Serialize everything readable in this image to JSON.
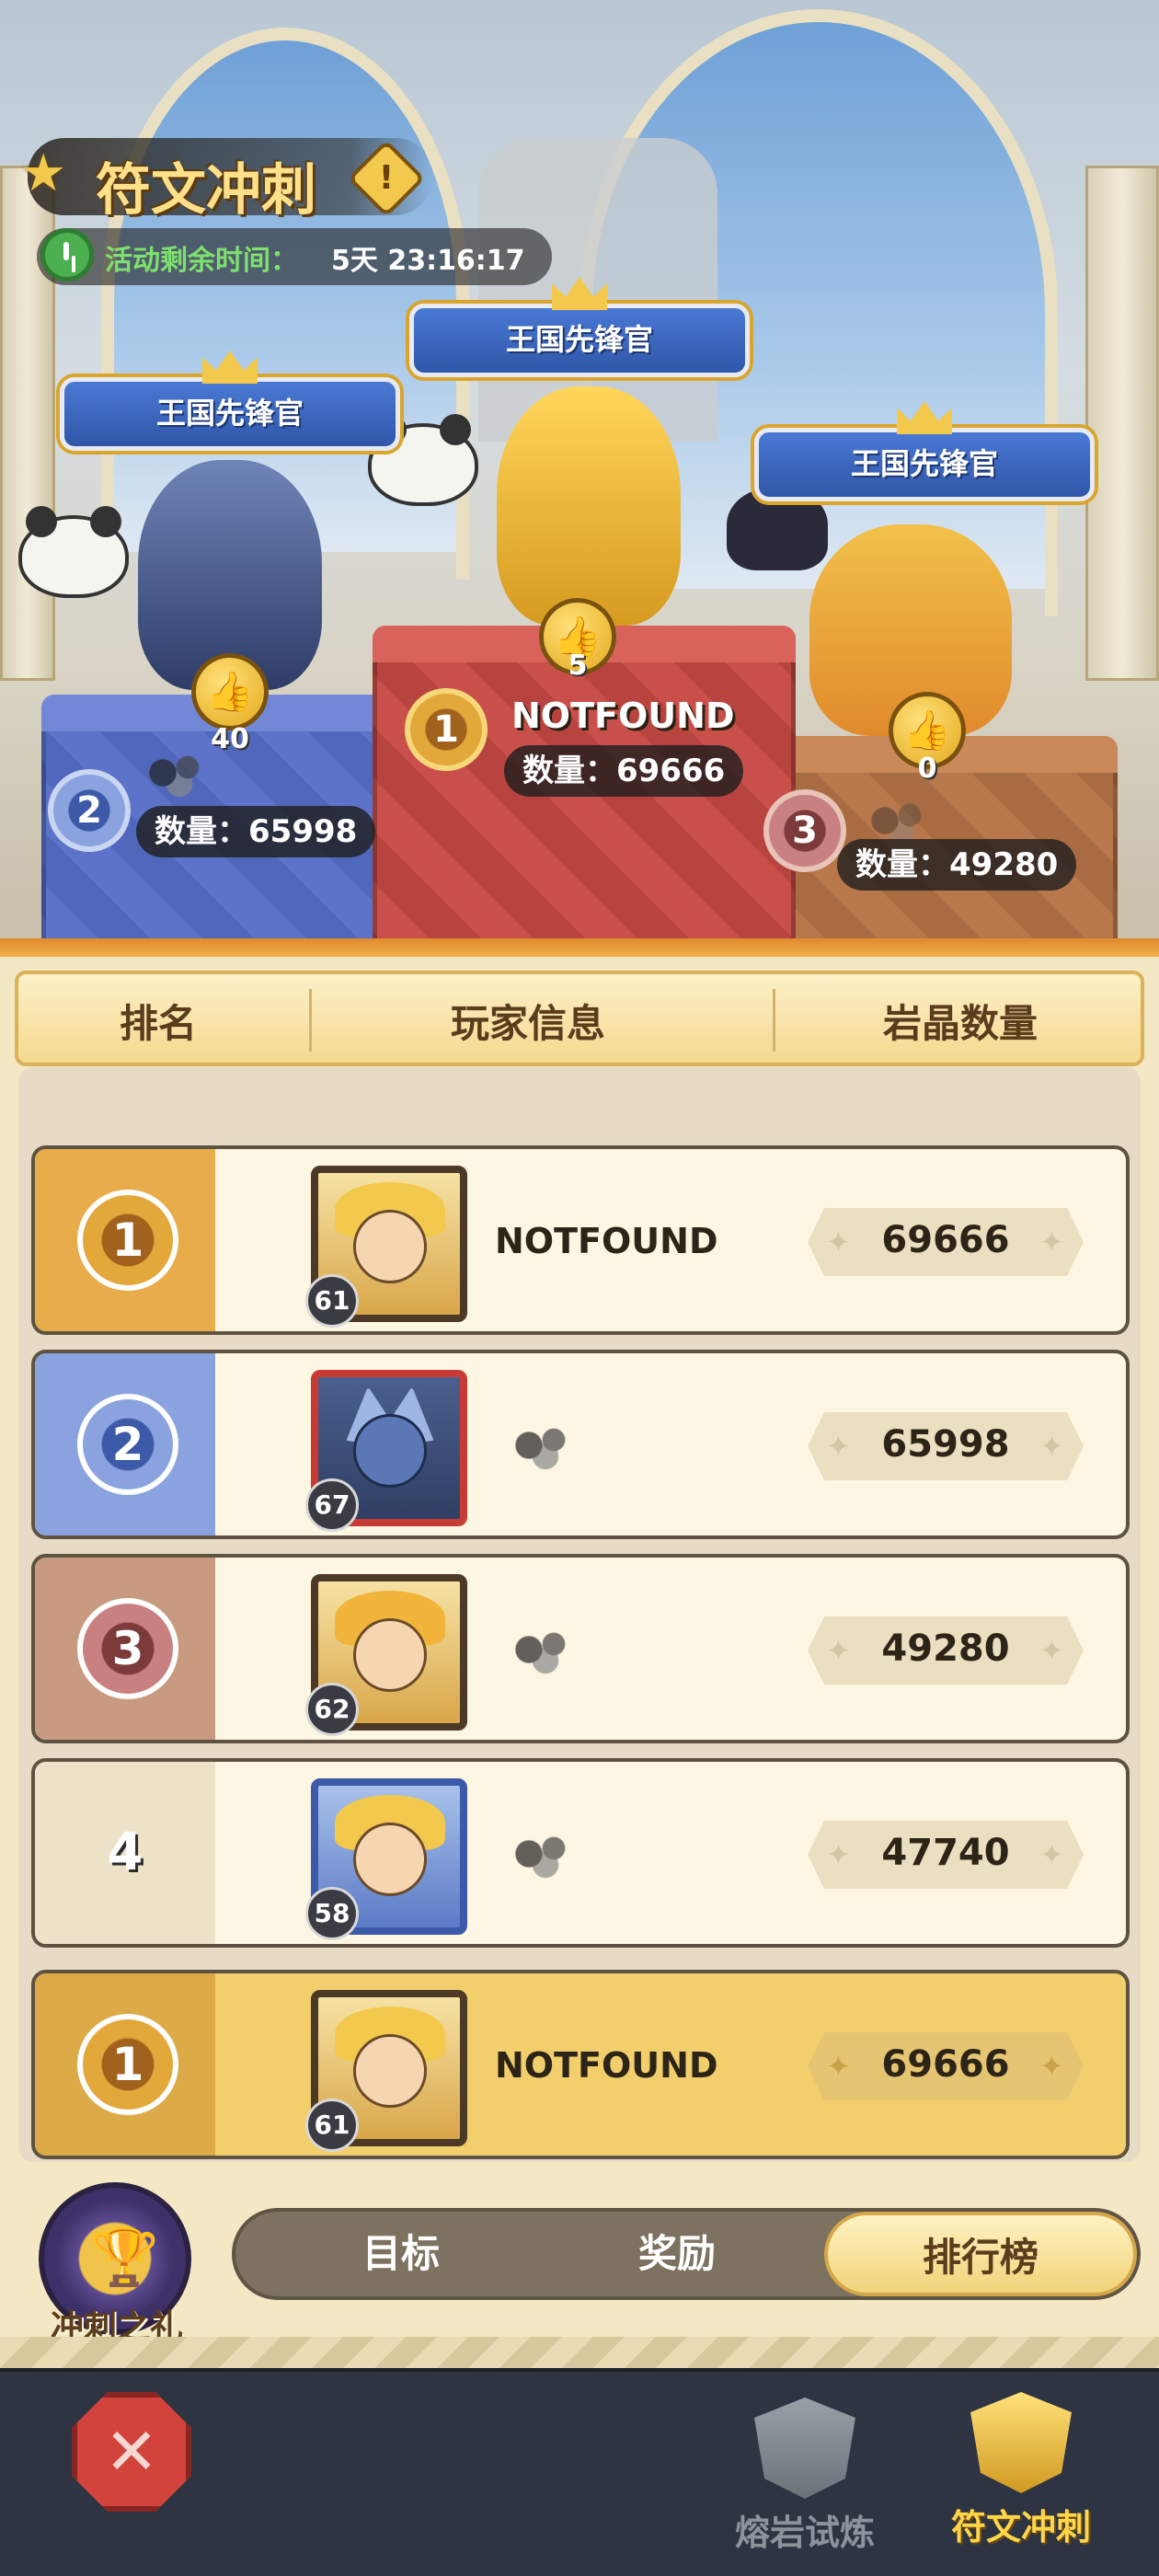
{
  "event": {
    "title": "符文冲刺",
    "timer_label": "活动剩余时间：",
    "timer_value": "5天 23:16:17"
  },
  "podium": {
    "banner_title": "王国先锋官",
    "first": {
      "name": "NOTFOUND",
      "likes": "5",
      "count": "数量：69666",
      "rank": "1"
    },
    "second": {
      "likes": "40",
      "count": "数量：65998",
      "rank": "2"
    },
    "third": {
      "likes": "0",
      "count": "数量：49280",
      "rank": "3"
    }
  },
  "table": {
    "headers": {
      "rank": "排名",
      "player": "玩家信息",
      "crystals": "岩晶数量"
    },
    "rows": [
      {
        "rank": "1",
        "level": "61",
        "name": "NOTFOUND",
        "crystals": "69666"
      },
      {
        "rank": "2",
        "level": "67",
        "name": "",
        "crystals": "65998"
      },
      {
        "rank": "3",
        "level": "62",
        "name": "",
        "crystals": "49280"
      },
      {
        "rank": "4",
        "level": "58",
        "name": "",
        "crystals": "47740"
      }
    ],
    "my_row": {
      "rank": "1",
      "level": "61",
      "name": "NOTFOUND",
      "crystals": "69666"
    }
  },
  "tabs": {
    "gift_label": "冲刺之礼",
    "items": [
      "目标",
      "奖励",
      "排行榜"
    ],
    "active": "排行榜"
  },
  "bottom_nav": {
    "close_icon": "crossed-swords-icon",
    "items": [
      {
        "label": "熔岩试炼",
        "icon": "shield-icon"
      },
      {
        "label": "符文冲刺",
        "icon": "sword-emblem-icon"
      }
    ]
  },
  "colors": {
    "gold": "#e8ad4a",
    "silver": "#8aa2de",
    "bronze": "#c89a80",
    "highlight_row": "#f2cf6c"
  }
}
